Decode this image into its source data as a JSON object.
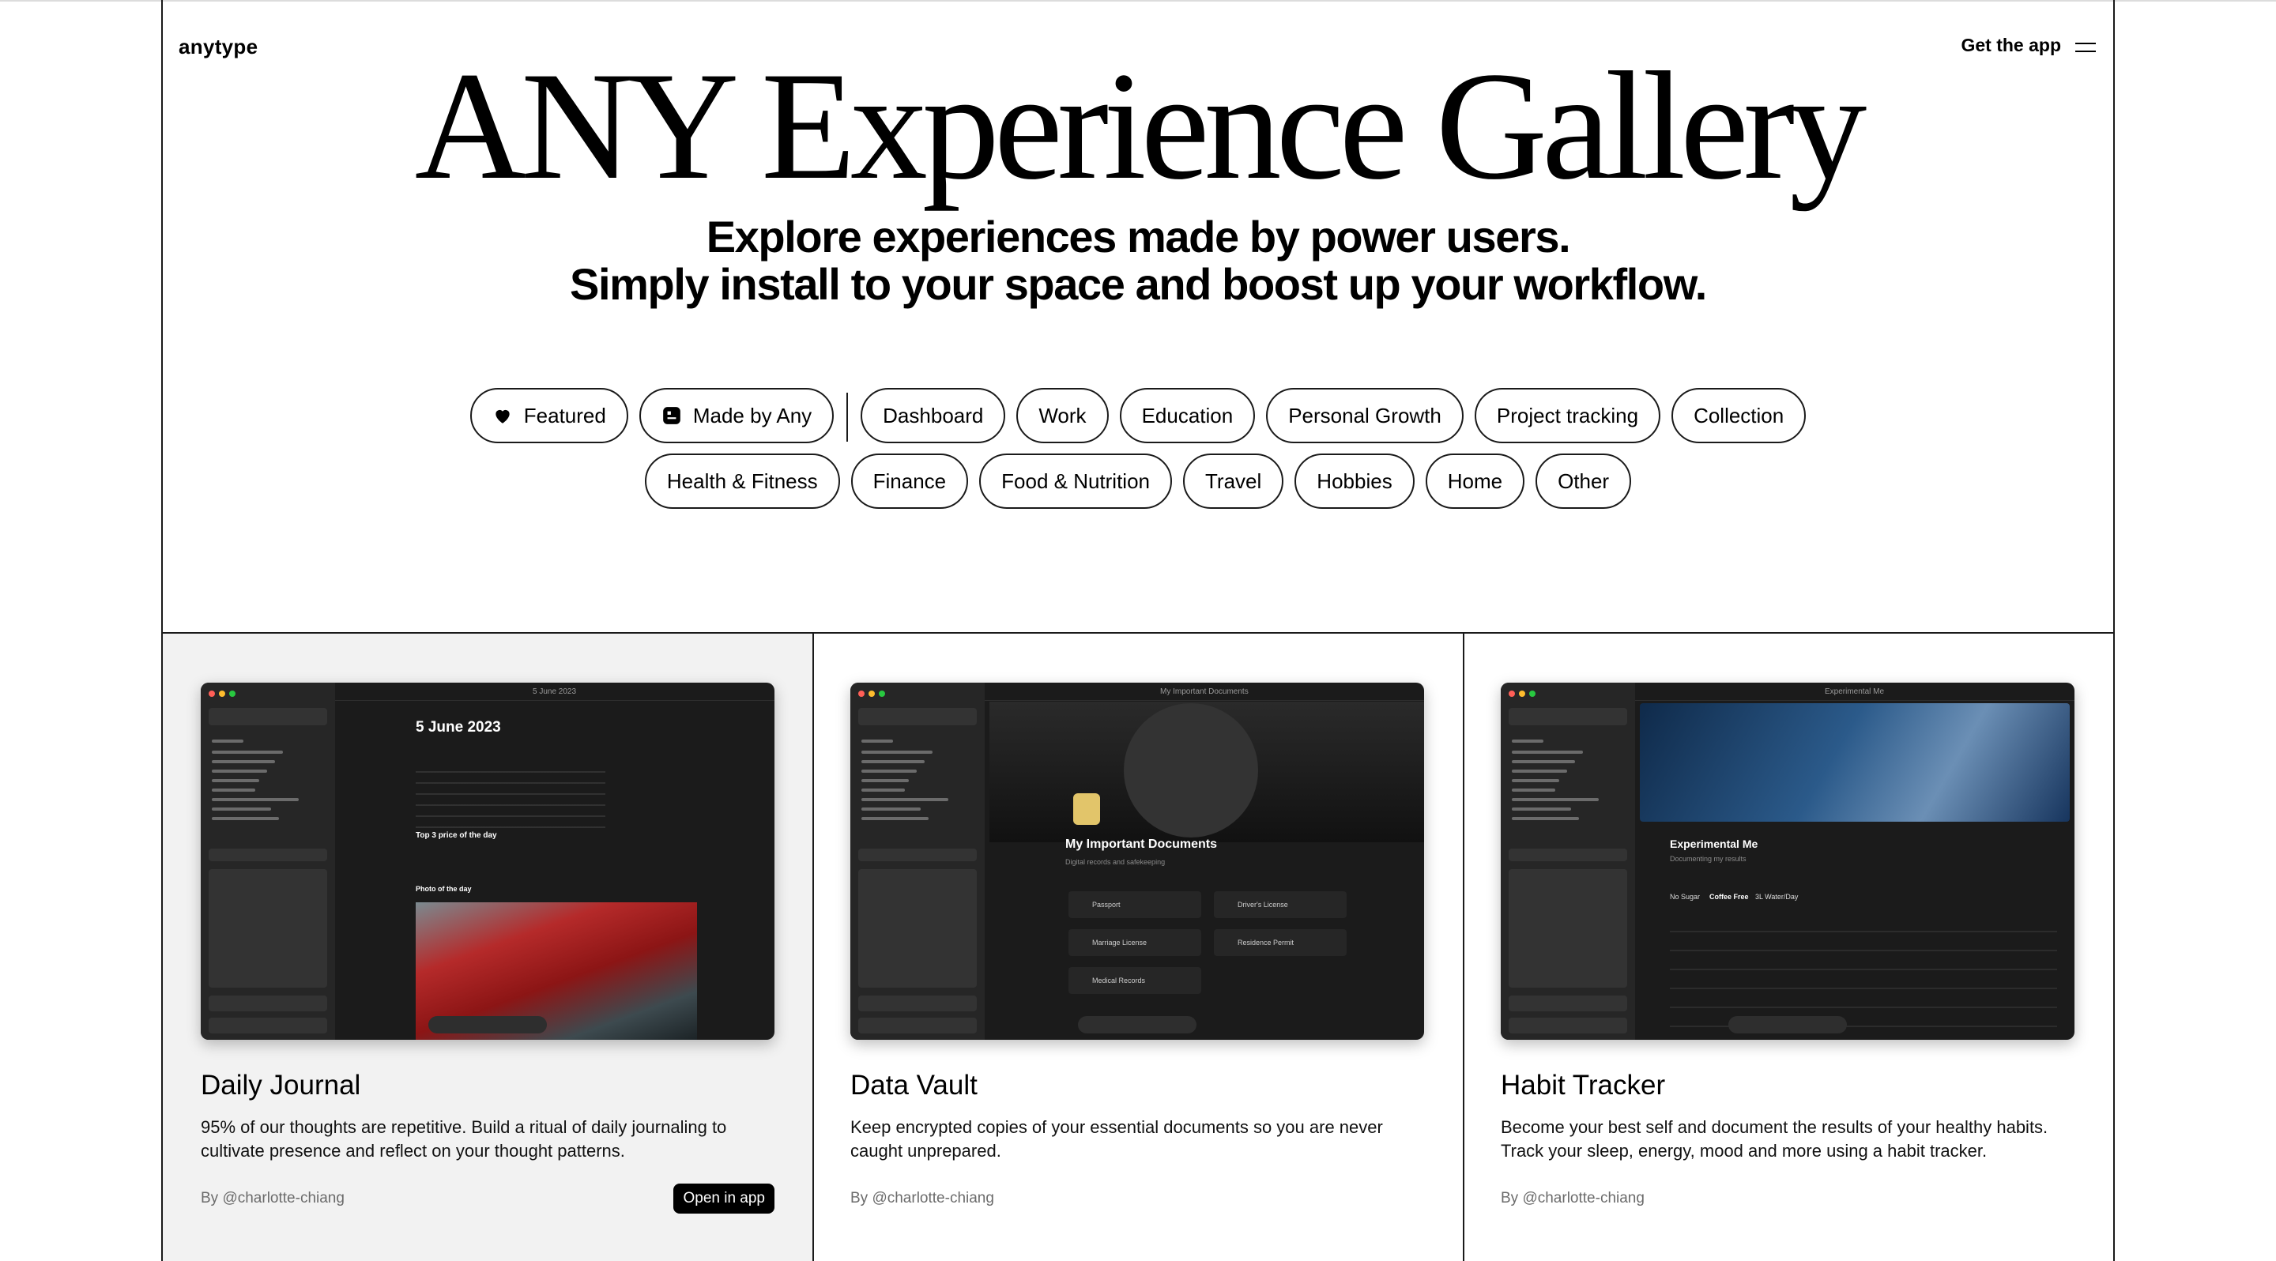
{
  "header": {
    "logo": "anytype",
    "get_app": "Get the app"
  },
  "hero": {
    "title": "ANY Experience Gallery",
    "subtitle_line1": "Explore experiences made by power users.",
    "subtitle_line2": "Simply install to your space and boost up your workflow."
  },
  "filters": {
    "row1": [
      {
        "label": "Featured",
        "icon": "heart-icon"
      },
      {
        "label": "Made by Any",
        "icon": "any-logo-icon"
      },
      {
        "label": "Dashboard"
      },
      {
        "label": "Work"
      },
      {
        "label": "Education"
      },
      {
        "label": "Personal Growth"
      },
      {
        "label": "Project tracking"
      },
      {
        "label": "Collection"
      }
    ],
    "row2": [
      {
        "label": "Health & Fitness"
      },
      {
        "label": "Finance"
      },
      {
        "label": "Food & Nutrition"
      },
      {
        "label": "Travel"
      },
      {
        "label": "Hobbies"
      },
      {
        "label": "Home"
      },
      {
        "label": "Other"
      }
    ]
  },
  "cards": [
    {
      "title": "Daily Journal",
      "description": "95% of our thoughts are repetitive. Build a ritual of daily journaling to cultivate presence and reflect on your thought patterns.",
      "author": "By @charlotte-chiang",
      "action": "Open in app",
      "preview": {
        "titlebar": "5 June 2023",
        "heading": "5 June 2023",
        "section": "Top 3 price of the day",
        "photo_label": "Photo of the day"
      }
    },
    {
      "title": "Data Vault",
      "description": "Keep encrypted copies of your essential documents so you are never caught unprepared.",
      "author": "By @charlotte-chiang",
      "preview": {
        "titlebar": "My Important Documents",
        "heading": "My Important Documents",
        "subheading": "Digital records and safekeeping",
        "items": [
          "Passport",
          "Driver's License",
          "Marriage License",
          "Residence Permit",
          "Medical Records"
        ]
      }
    },
    {
      "title": "Habit Tracker",
      "description": "Become your best self and document the results of your healthy habits. Track your sleep, energy, mood and more using a habit tracker.",
      "author": "By @charlotte-chiang",
      "preview": {
        "titlebar": "Experimental Me",
        "heading": "Experimental Me",
        "subheading": "Documenting my results",
        "tabs": [
          "No Sugar",
          "Coffee Free",
          "3L Water/Day"
        ]
      }
    }
  ],
  "colors": {
    "ink": "#000000",
    "selected_card_bg": "#f2f2f2",
    "preview_bg": "#1b1b1b",
    "mac_red": "#ff5f57",
    "mac_yellow": "#febc2e",
    "mac_green": "#28c840"
  }
}
